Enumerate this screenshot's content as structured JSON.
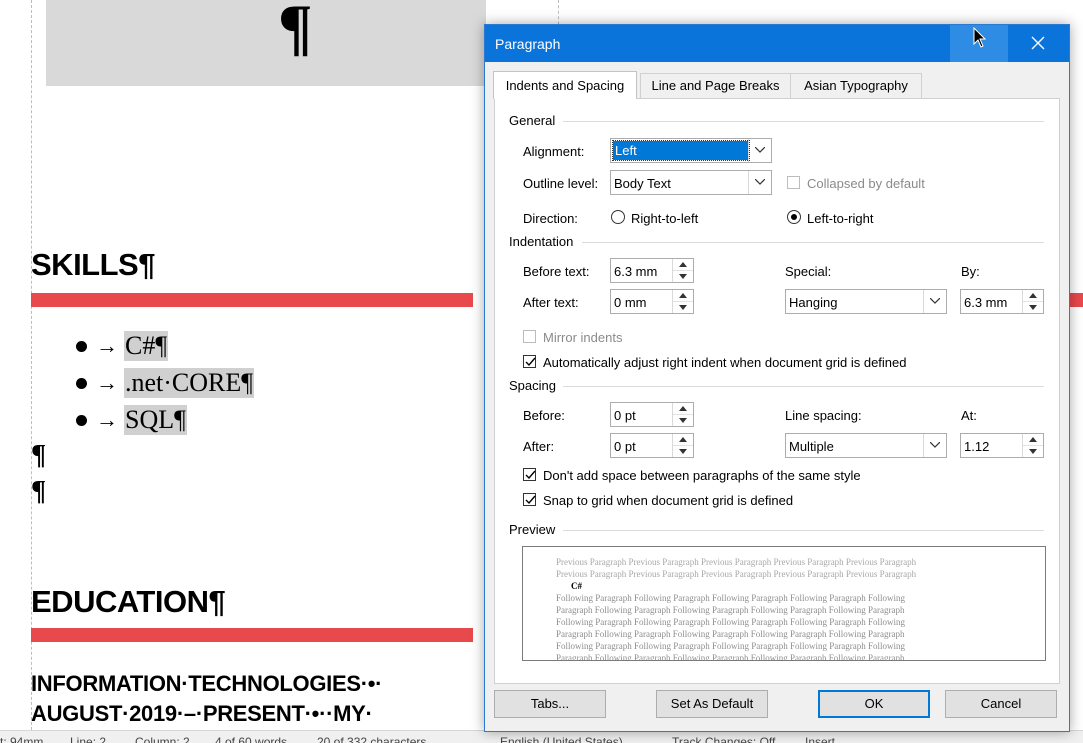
{
  "document": {
    "big_mark": "¶",
    "skills_heading": "SKILLS¶",
    "skills": [
      "C#¶",
      ".net·CORE¶",
      "SQL¶"
    ],
    "bullet_arrow": "→",
    "empty_para": "¶",
    "education_heading": "EDUCATION¶",
    "education_line1": "INFORMATION·TECHNOLOGIES·•·",
    "education_line2": "AUGUST·2019·–·PRESENT·•··MY·"
  },
  "status_bar": {
    "at": "t: 94mm",
    "line": "Line: 2",
    "column": "Column: 2",
    "words": "4 of 60 words",
    "chars": "20 of 332 characters",
    "language": "English (United States)",
    "track_changes": "Track Changes: Off",
    "mode": "Insert"
  },
  "dialog": {
    "title": "Paragraph",
    "tabs": [
      "Indents and Spacing",
      "Line and Page Breaks",
      "Asian Typography"
    ],
    "general": {
      "label": "General",
      "alignment_label": "Alignment:",
      "alignment_value": "Left",
      "outline_label": "Outline level:",
      "outline_value": "Body Text",
      "collapsed_label": "Collapsed by default",
      "direction_label": "Direction:",
      "rtl_label": "Right-to-left",
      "ltr_label": "Left-to-right"
    },
    "indentation": {
      "label": "Indentation",
      "before_label": "Before text:",
      "before_value": "6.3 mm",
      "after_label": "After text:",
      "after_value": "0 mm",
      "special_label": "Special:",
      "special_value": "Hanging",
      "by_label": "By:",
      "by_value": "6.3 mm",
      "mirror_label": "Mirror indents",
      "auto_adjust_label": "Automatically adjust right indent when document grid is defined"
    },
    "spacing": {
      "label": "Spacing",
      "before_label": "Before:",
      "before_value": "0 pt",
      "after_label": "After:",
      "after_value": "0 pt",
      "line_spacing_label": "Line spacing:",
      "line_spacing_value": "Multiple",
      "at_label": "At:",
      "at_value": "1.12",
      "dont_add_label": "Don't add space between paragraphs of the same style",
      "snap_label": "Snap to grid when document grid is defined"
    },
    "preview": {
      "label": "Preview",
      "previous_lines": [
        "Previous Paragraph Previous Paragraph Previous Paragraph Previous Paragraph Previous Paragraph",
        "Previous Paragraph Previous Paragraph Previous Paragraph Previous Paragraph Previous Paragraph"
      ],
      "current_text": "C#",
      "following_lines": [
        "Following Paragraph Following Paragraph Following Paragraph Following Paragraph Following",
        "Paragraph Following Paragraph Following Paragraph Following Paragraph Following Paragraph",
        "Following Paragraph Following Paragraph Following Paragraph Following Paragraph Following",
        "Paragraph Following Paragraph Following Paragraph Following Paragraph Following Paragraph",
        "Following Paragraph Following Paragraph Following Paragraph Following Paragraph Following",
        "Paragraph Following Paragraph Following Paragraph Following Paragraph Following Paragraph"
      ]
    },
    "buttons": {
      "tabs": "Tabs...",
      "set_default": "Set As Default",
      "ok": "OK",
      "cancel": "Cancel"
    }
  }
}
